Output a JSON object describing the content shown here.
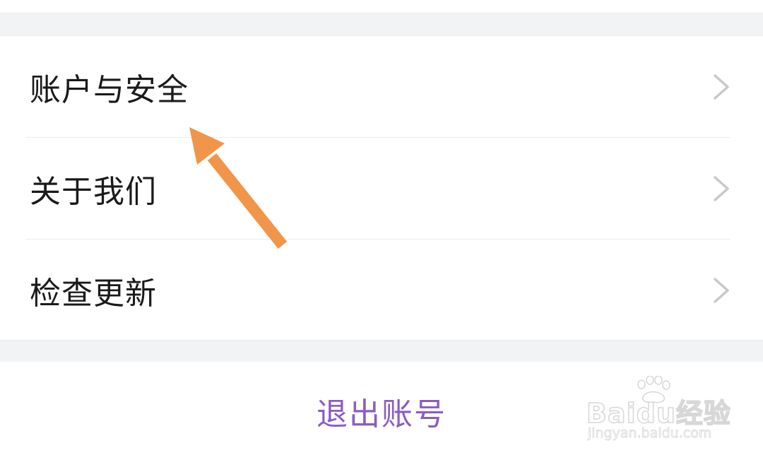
{
  "menu": {
    "items": [
      {
        "label": "账户与安全",
        "chevron": "chevron-right-icon"
      },
      {
        "label": "关于我们",
        "chevron": "chevron-right-icon"
      },
      {
        "label": "检查更新",
        "chevron": "chevron-right-icon"
      }
    ]
  },
  "logout": {
    "label": "退出账号"
  },
  "annotation": {
    "icon": "arrow-icon",
    "color": "#f0954a"
  },
  "watermark": {
    "main": "Baidu经验",
    "sub": "jingyan.baidu.com"
  },
  "colors": {
    "accent": "#8a5cc4",
    "separator": "#f2f3f5",
    "chevron": "#c8c8c8",
    "text": "#1a1a1a"
  }
}
